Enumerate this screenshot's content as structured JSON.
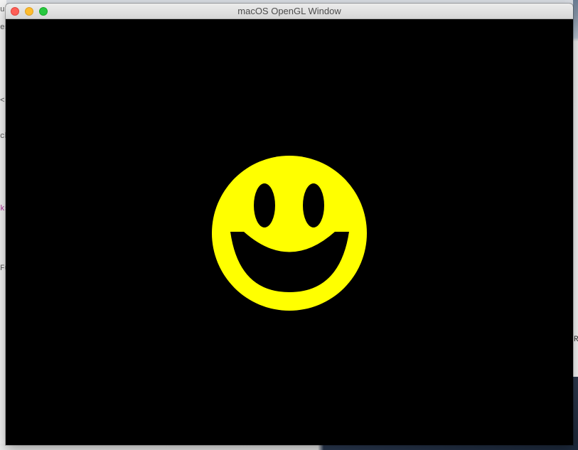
{
  "window": {
    "title": "macOS OpenGL Window",
    "controls": {
      "close": "close-button",
      "minimize": "minimize-button",
      "zoom": "zoom-button"
    }
  },
  "scene": {
    "background_color": "#000000",
    "face_color": "#ffff00",
    "feature_color": "#000000"
  },
  "background_fragments": {
    "left": [
      "ur",
      "es",
      "<)",
      "ch",
      "ks",
      "Fu"
    ],
    "right": "RE"
  }
}
